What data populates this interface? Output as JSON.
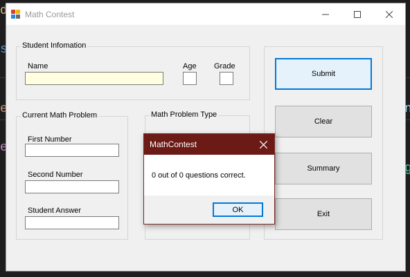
{
  "window": {
    "title": "Math Contest"
  },
  "background": {
    "glyphs": [
      "d",
      "s",
      "e",
      "e",
      "n",
      "g"
    ]
  },
  "student_info": {
    "group_label": "Student Infomation",
    "name_label": "Name",
    "name_value": "",
    "age_label": "Age",
    "age_value": "",
    "grade_label": "Grade",
    "grade_value": ""
  },
  "current_problem": {
    "group_label": "Current Math Problem",
    "first_label": "First Number",
    "first_value": "",
    "second_label": "Second Number",
    "second_value": "",
    "answer_label": "Student Answer",
    "answer_value": ""
  },
  "problem_type": {
    "group_label": "Math Problem Type"
  },
  "actions": {
    "submit": "Submit",
    "clear": "Clear",
    "summary": "Summary",
    "exit": "Exit"
  },
  "dialog": {
    "title": "MathContest",
    "message": "0 out of 0 questions correct.",
    "ok": "OK"
  },
  "colors": {
    "accent": "#0078d7",
    "dialog_title": "#6b1a16",
    "name_field": "#ffffe0"
  }
}
